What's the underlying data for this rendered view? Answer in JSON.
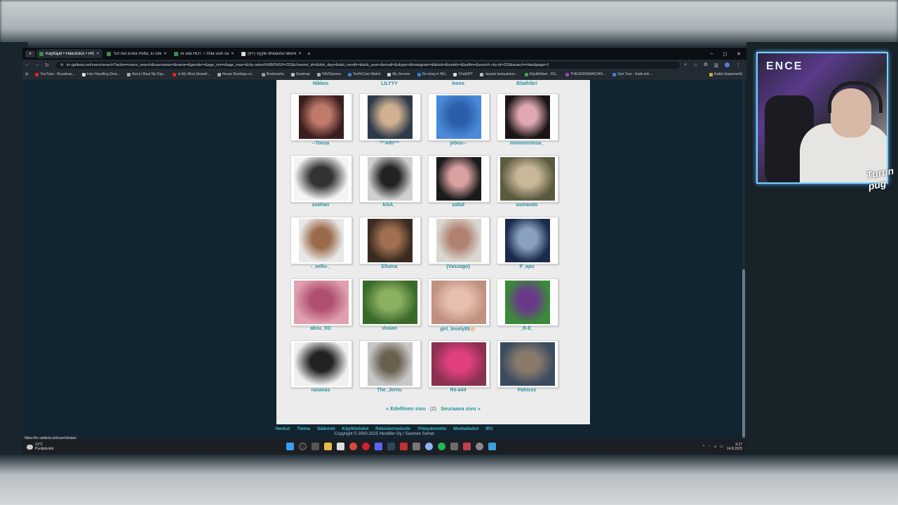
{
  "browser": {
    "tabs": [
      {
        "title": "Käyttäjät • Hakutulos • IRC-Galleria",
        "active": true
      },
      {
        "title": "\"En Aio Enkä Pelta. Ei Olen Sei",
        "active": false
      },
      {
        "title": "Ai sitä HOT 7 mitä voin sanoi",
        "active": false
      },
      {
        "title": "(9+) Syyte tihkaistui liikenneil",
        "active": false
      }
    ],
    "url": "irc-galleria.net/users/search?action=users_search&username=&name=&gender=&age_min=&age_max=&city-select%5B0%5D=253&channel_id=&dob_day=&dob_month=&dob_year=&email=&skype=&instagram=&tiktok=&tumblr=&lastfm=&search-city-id=253&search=Hae&page=1",
    "bookmarks": [
      "YouTube - Broadcas...",
      "Inter Handling Grou...",
      "Avicii | Beat My Day...",
      "In My Mind (Axwell...",
      "House Bootlegs.co...",
      "Bookmarks",
      "Seatmap",
      "VAVGlasses",
      "TenNrCam Watch",
      "My Servers",
      "De-icing in HEL",
      "ChatGPT",
      "Jazzari laskuatulun...",
      "Käyttötiliset - RS...",
      "THEGRINDMACHIN...",
      "Geri Tree - Kalle kok..."
    ],
    "bookmarks_right": "Kaikki kirjanmerkit"
  },
  "gallery": {
    "previous_row": [
      "Nikkes",
      "LILYYY",
      "leeeo",
      "Bilalhibri"
    ],
    "users": [
      {
        "name": "--Tonza"
      },
      {
        "name": "^^ARI^^"
      },
      {
        "name": "jebou--"
      },
      {
        "name": "moioonroosa_"
      },
      {
        "name": "zoohan"
      },
      {
        "name": "kiiiA_"
      },
      {
        "name": "sallaf"
      },
      {
        "name": "osmando"
      },
      {
        "name": "-_vellu-_"
      },
      {
        "name": "Elluina"
      },
      {
        "name": "{Vassago}"
      },
      {
        "name": "P_apu"
      },
      {
        "name": "aksu_XD"
      },
      {
        "name": "shaian"
      },
      {
        "name": "girl_lovely88🎂"
      },
      {
        "name": "_B-E_"
      },
      {
        "name": "rananas"
      },
      {
        "name": "The_Jernu"
      },
      {
        "name": "Rii-a44"
      },
      {
        "name": "Pahisss"
      }
    ],
    "pager": {
      "prev": "« Edellinen sivu",
      "current": "(2)",
      "next": "Seuraava sivu »"
    }
  },
  "footer": {
    "links": [
      "Herkut",
      "Tietoa",
      "Säännöt",
      "Käyttöehdot",
      "Rekisteriseloste",
      "Yhteydenotto",
      "Mediatiedot",
      "IRC"
    ],
    "copyright": "Copyright © 2000-2025 Herdifier Oy / Suomen Somet"
  },
  "status_url": "https://irc-galleria.net/user/shaian",
  "taskbar": {
    "temp": "13°C",
    "weather": "Puolipilvistä",
    "time": "9.27",
    "date": "14.8.2025"
  },
  "webcam": {
    "logo": "ENCE",
    "overlay": "Turun pug"
  }
}
